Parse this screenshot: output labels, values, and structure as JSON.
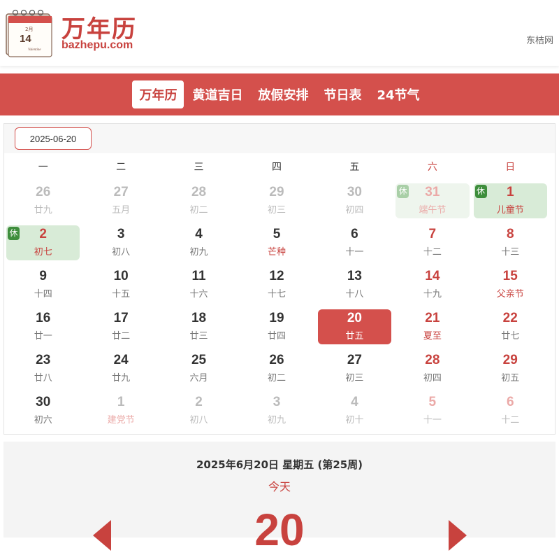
{
  "header": {
    "logo_title": "万年历",
    "logo_domain": "bazhepu.com",
    "logo_card_month": "2月",
    "logo_card_day": "14",
    "logo_card_note": "Valentine",
    "site_name": "东桔网"
  },
  "nav": {
    "items": [
      "万年历",
      "黄道吉日",
      "放假安排",
      "节日表",
      "24节气"
    ],
    "active_index": 0
  },
  "calendar": {
    "selected_date": "2025-06-20",
    "weekdays": [
      "一",
      "二",
      "三",
      "四",
      "五",
      "六",
      "日"
    ],
    "rest_label": "休",
    "weeks": [
      [
        {
          "day": "26",
          "lunar": "廿九",
          "other": true
        },
        {
          "day": "27",
          "lunar": "五月",
          "other": true
        },
        {
          "day": "28",
          "lunar": "初二",
          "other": true
        },
        {
          "day": "29",
          "lunar": "初三",
          "other": true
        },
        {
          "day": "30",
          "lunar": "初四",
          "other": true
        },
        {
          "day": "31",
          "lunar": "端午节",
          "other": true,
          "festival": true,
          "holiday": true
        },
        {
          "day": "1",
          "lunar": "儿童节",
          "festival": true,
          "holiday": true
        }
      ],
      [
        {
          "day": "2",
          "lunar": "初七",
          "festival": true,
          "holiday": true,
          "red_day": true
        },
        {
          "day": "3",
          "lunar": "初八"
        },
        {
          "day": "4",
          "lunar": "初九"
        },
        {
          "day": "5",
          "lunar": "芒种",
          "festival": true
        },
        {
          "day": "6",
          "lunar": "十一"
        },
        {
          "day": "7",
          "lunar": "十二"
        },
        {
          "day": "8",
          "lunar": "十三"
        }
      ],
      [
        {
          "day": "9",
          "lunar": "十四"
        },
        {
          "day": "10",
          "lunar": "十五"
        },
        {
          "day": "11",
          "lunar": "十六"
        },
        {
          "day": "12",
          "lunar": "十七"
        },
        {
          "day": "13",
          "lunar": "十八"
        },
        {
          "day": "14",
          "lunar": "十九"
        },
        {
          "day": "15",
          "lunar": "父亲节",
          "festival": true
        }
      ],
      [
        {
          "day": "16",
          "lunar": "廿一"
        },
        {
          "day": "17",
          "lunar": "廿二"
        },
        {
          "day": "18",
          "lunar": "廿三"
        },
        {
          "day": "19",
          "lunar": "廿四"
        },
        {
          "day": "20",
          "lunar": "廿五",
          "today": true
        },
        {
          "day": "21",
          "lunar": "夏至",
          "festival": true
        },
        {
          "day": "22",
          "lunar": "廿七"
        }
      ],
      [
        {
          "day": "23",
          "lunar": "廿八"
        },
        {
          "day": "24",
          "lunar": "廿九"
        },
        {
          "day": "25",
          "lunar": "六月"
        },
        {
          "day": "26",
          "lunar": "初二"
        },
        {
          "day": "27",
          "lunar": "初三"
        },
        {
          "day": "28",
          "lunar": "初四"
        },
        {
          "day": "29",
          "lunar": "初五"
        }
      ],
      [
        {
          "day": "30",
          "lunar": "初六"
        },
        {
          "day": "1",
          "lunar": "建党节",
          "other": true,
          "festival": true
        },
        {
          "day": "2",
          "lunar": "初八",
          "other": true
        },
        {
          "day": "3",
          "lunar": "初九",
          "other": true
        },
        {
          "day": "4",
          "lunar": "初十",
          "other": true
        },
        {
          "day": "5",
          "lunar": "十一",
          "other": true
        },
        {
          "day": "6",
          "lunar": "十二",
          "other": true
        }
      ]
    ]
  },
  "detail": {
    "full_date": "2025年6月20日 星期五 (第25周)",
    "today_label": "今天",
    "big_day": "20"
  },
  "colors": {
    "accent": "#d4504c",
    "holiday_bg": "#d8ebd7",
    "rest_badge": "#3e8e3c"
  }
}
